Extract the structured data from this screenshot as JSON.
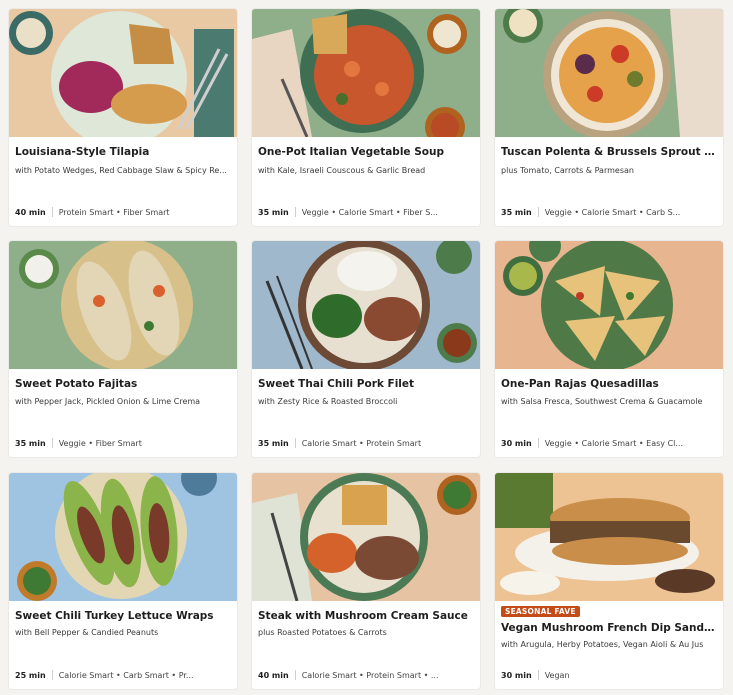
{
  "recipes": [
    {
      "title": "Louisiana-Style Tilapia",
      "subtitle": "with Potato Wedges, Red Cabbage Slaw & Spicy Re...",
      "time": "40 min",
      "tags": "Protein Smart • Fiber Smart",
      "bg": "#e9c9a4",
      "plate": "#dfe7d8",
      "food": "#d59c4d"
    },
    {
      "title": "One-Pot Italian Vegetable Soup",
      "subtitle": "with Kale, Israeli Couscous & Garlic Bread",
      "time": "35 min",
      "tags": "Veggie • Calorie Smart • Fiber S...",
      "bg": "#8fae8a",
      "plate": "#3f6e52",
      "food": "#c9572e"
    },
    {
      "title": "Tuscan Polenta & Brussels Sprout Bowls",
      "subtitle": "plus Tomato, Carrots & Parmesan",
      "time": "35 min",
      "tags": "Veggie • Calorie Smart • Carb S...",
      "bg": "#8fae8a",
      "plate": "#efe6d5",
      "food": "#e5a24a"
    },
    {
      "title": "Sweet Potato Fajitas",
      "subtitle": "with Pepper Jack, Pickled Onion & Lime Crema",
      "time": "35 min",
      "tags": "Veggie • Fiber Smart",
      "bg": "#8fae8a",
      "plate": "#d8c08a",
      "food": "#e2d6b6"
    },
    {
      "title": "Sweet Thai Chili Pork Filet",
      "subtitle": "with Zesty Rice & Roasted Broccoli",
      "time": "35 min",
      "tags": "Calorie Smart • Protein Smart",
      "bg": "#9fb8cc",
      "plate": "#6d4a36",
      "food": "#2f6b2a"
    },
    {
      "title": "One-Pan Rajas Quesadillas",
      "subtitle": "with Salsa Fresca, Southwest Crema & Guacamole",
      "time": "30 min",
      "tags": "Veggie • Calorie Smart • Easy Cl...",
      "bg": "#e7b58f",
      "plate": "#4f7a48",
      "food": "#e6c27a"
    },
    {
      "title": "Sweet Chili Turkey Lettuce Wraps",
      "subtitle": "with Bell Pepper & Candied Peanuts",
      "time": "25 min",
      "tags": "Calorie Smart • Carb Smart • Pr...",
      "bg": "#9ec4e2",
      "plate": "#e3d6b3",
      "food": "#8bb44a"
    },
    {
      "title": "Steak with Mushroom Cream Sauce",
      "subtitle": "plus Roasted Potatoes & Carrots",
      "time": "40 min",
      "tags": "Calorie Smart • Protein Smart • ...",
      "bg": "#e6c3a2",
      "plate": "#4c7a55",
      "food": "#d9a24f"
    },
    {
      "title": "Vegan Mushroom French Dip Sandwiches",
      "subtitle": "with Arugula, Herby Potatoes, Vegan Aioli & Au Jus",
      "time": "30 min",
      "tags": "Vegan",
      "badge": "SEASONAL FAVE",
      "bg": "#edc394",
      "plate": "#f4f1ea",
      "food": "#c98f4a"
    }
  ]
}
